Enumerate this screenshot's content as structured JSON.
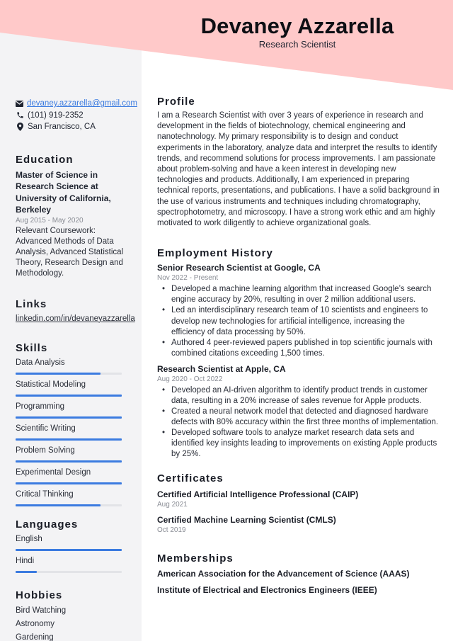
{
  "colors": {
    "banner": "#ffc9c9",
    "sidebar_bg": "#f3f3f5",
    "accent": "#3b7be0",
    "bar_track": "#e2e3e7"
  },
  "header": {
    "name": "Devaney Azzarella",
    "role": "Research Scientist"
  },
  "contact": {
    "email": "devaney.azzarella@gmail.com",
    "phone": "(101) 919-2352",
    "location": "San Francisco, CA",
    "icons": [
      "envelope-icon",
      "phone-icon",
      "map-pin-icon"
    ]
  },
  "education": {
    "heading": "Education",
    "degree": "Master of Science in Research Science at University of California, Berkeley",
    "dates": "Aug 2015 - May 2020",
    "coursework": "Relevant Coursework: Advanced Methods of Data Analysis, Advanced Statistical Theory, Research Design and Methodology."
  },
  "links": {
    "heading": "Links",
    "items": [
      "linkedin.com/in/devaneyazzarella"
    ]
  },
  "skills": {
    "heading": "Skills",
    "items": [
      {
        "label": "Data Analysis",
        "level": 0.8
      },
      {
        "label": "Statistical Modeling",
        "level": 1.0
      },
      {
        "label": "Programming",
        "level": 1.0
      },
      {
        "label": "Scientific Writing",
        "level": 1.0
      },
      {
        "label": "Problem Solving",
        "level": 1.0
      },
      {
        "label": "Experimental Design",
        "level": 1.0
      },
      {
        "label": "Critical Thinking",
        "level": 0.8
      }
    ]
  },
  "languages": {
    "heading": "Languages",
    "items": [
      {
        "label": "English",
        "level": 1.0
      },
      {
        "label": "Hindi",
        "level": 0.2
      }
    ]
  },
  "hobbies": {
    "heading": "Hobbies",
    "items": [
      "Bird Watching",
      "Astronomy",
      "Gardening"
    ]
  },
  "profile": {
    "heading": "Profile",
    "text": "I am a Research Scientist with over 3 years of experience in research and development in the fields of biotechnology, chemical engineering and nanotechnology. My primary responsibility is to design and conduct experiments in the laboratory, analyze data and interpret the results to identify trends, and recommend solutions for process improvements. I am passionate about problem-solving and have a keen interest in developing new technologies and products. Additionally, I am experienced in preparing technical reports, presentations, and publications. I have a solid background in the use of various instruments and techniques including chromatography, spectrophotometry, and microscopy. I have a strong work ethic and am highly motivated to work diligently to achieve organizational goals."
  },
  "employment": {
    "heading": "Employment History",
    "jobs": [
      {
        "title": "Senior Research Scientist at Google, CA",
        "dates": "Nov 2022 - Present",
        "bullets": [
          "Developed a machine learning algorithm that increased Google’s search engine accuracy by 20%, resulting in over 2 million additional users.",
          "Led an interdisciplinary research team of 10 scientists and engineers to develop new technologies for artificial intelligence, increasing the efficiency of data processing by 50%.",
          "Authored 4 peer-reviewed papers published in top scientific journals with combined citations exceeding 1,500 times."
        ]
      },
      {
        "title": "Research Scientist at Apple, CA",
        "dates": "Aug 2020 - Oct 2022",
        "bullets": [
          "Developed an AI-driven algorithm to identify product trends in customer data, resulting in a 20% increase of sales revenue for Apple products.",
          "Created a neural network model that detected and diagnosed hardware defects with 80% accuracy within the first three months of implementation.",
          "Developed software tools to analyze market research data sets and identified key insights leading to improvements on existing Apple products by 25%."
        ]
      }
    ]
  },
  "certificates": {
    "heading": "Certificates",
    "items": [
      {
        "title": "Certified Artificial Intelligence Professional (CAIP)",
        "date": "Aug 2021"
      },
      {
        "title": "Certified Machine Learning Scientist (CMLS)",
        "date": "Oct 2019"
      }
    ]
  },
  "memberships": {
    "heading": "Memberships",
    "items": [
      "American Association for the Advancement of Science (AAAS)",
      "Institute of Electrical and Electronics Engineers (IEEE)"
    ]
  }
}
